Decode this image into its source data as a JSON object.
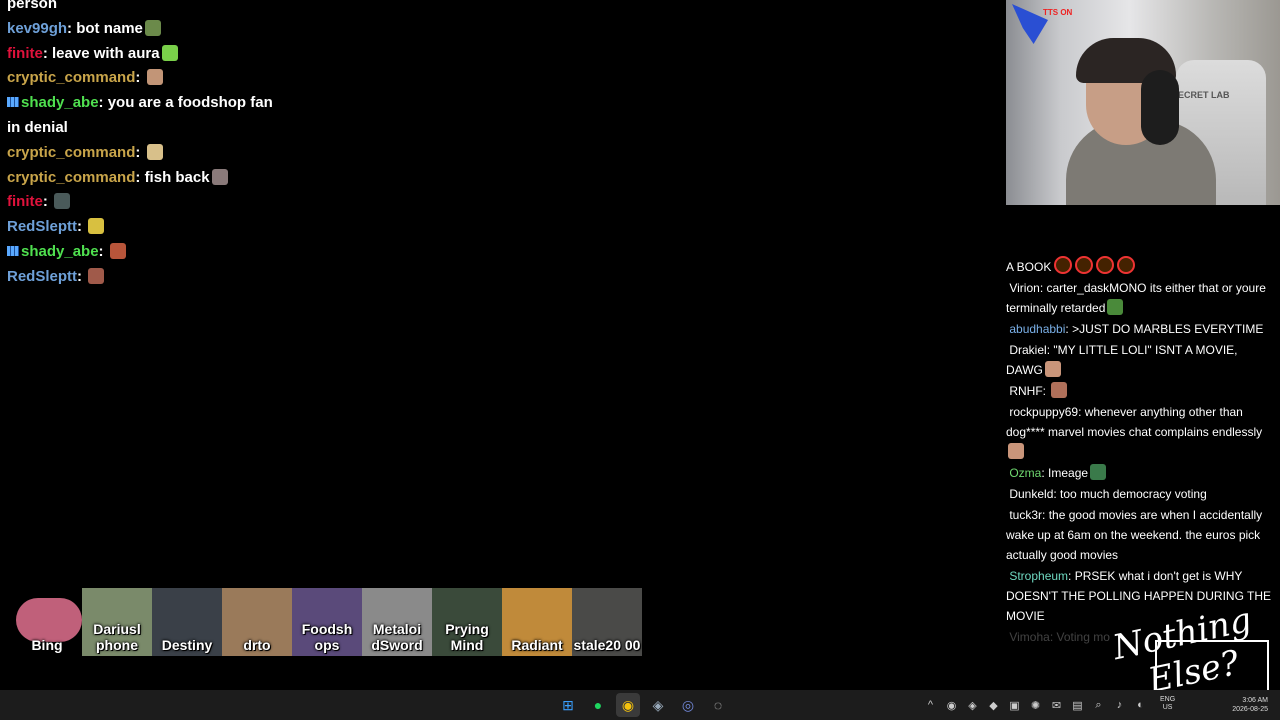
{
  "left_chat": {
    "lines": [
      {
        "user": "",
        "color": "#ffffff",
        "text": "person",
        "emote": false,
        "badge": false
      },
      {
        "user": "kev99gh",
        "color": "#6ea0d8",
        "text": "bot name",
        "emote": true,
        "emote_color": "#6b8a4a",
        "badge": false
      },
      {
        "user": "finite",
        "color": "#e0123c",
        "text": "leave with aura",
        "emote": true,
        "emote_color": "#7ad04a",
        "badge": false
      },
      {
        "user": "cryptic_command",
        "color": "#c9a54a",
        "text": "",
        "emote": true,
        "emote_color": "#c29577",
        "badge": false
      },
      {
        "user": "shady_abe",
        "color": "#4fe04f",
        "text": "you are a foodshop fan",
        "emote": false,
        "badge": true
      },
      {
        "user": "",
        "color": "#ffffff",
        "text": "in denial",
        "emote": false,
        "badge": false
      },
      {
        "user": "cryptic_command",
        "color": "#c9a54a",
        "text": "",
        "emote": true,
        "emote_color": "#d8c08a",
        "badge": false
      },
      {
        "user": "cryptic_command",
        "color": "#c9a54a",
        "text": "fish back",
        "emote": true,
        "emote_color": "#8a7a7a",
        "badge": false
      },
      {
        "user": "finite",
        "color": "#e0123c",
        "text": "",
        "emote": true,
        "emote_color": "#4a5a5a",
        "badge": false
      },
      {
        "user": "RedSleptt",
        "color": "#6ea0d8",
        "text": "",
        "emote": true,
        "emote_color": "#d8c040",
        "badge": false
      },
      {
        "user": "shady_abe",
        "color": "#4fe04f",
        "text": "",
        "emote": true,
        "emote_color": "#b8553a",
        "badge": true
      },
      {
        "user": "RedSleptt",
        "color": "#6ea0d8",
        "text": "",
        "emote": true,
        "emote_color": "#a05a4a",
        "badge": false
      }
    ]
  },
  "webcam": {
    "overlay_text": "TTS ON",
    "chair_text": "ECRET LAB"
  },
  "right_chat": {
    "messages": [
      {
        "user": "",
        "color": "#ffffff",
        "text": "A BOOK",
        "circles": 4
      },
      {
        "user": "Virion",
        "color": "#ffffff",
        "text": "carter_daskMONO its either that or youre terminally retarded",
        "emote": true,
        "emote_color": "#4a8a3a"
      },
      {
        "user": "abudhabbi",
        "color": "#7ab0e8",
        "text": ">JUST DO MARBLES EVERYTIME"
      },
      {
        "user": "Drakiel",
        "color": "#ffffff",
        "text": "\"MY LITTLE LOLI\" ISNT A MOVIE, DAWG",
        "emote": true,
        "emote_color": "#c9957a"
      },
      {
        "user": "RNHF",
        "color": "#ffffff",
        "text": "",
        "emote": true,
        "emote_color": "#b0705a"
      },
      {
        "user": "rockpuppy69",
        "color": "#ffffff",
        "text": "whenever anything other than dog**** marvel movies chat complains endlessly",
        "emote": true,
        "emote_color": "#c9957a"
      },
      {
        "user": "Ozma",
        "color": "#6fd86f",
        "text": "Imeage",
        "emote": true,
        "emote_color": "#3a7a4a"
      },
      {
        "user": "Dunkeld",
        "color": "#ffffff",
        "text": "too much democracy voting"
      },
      {
        "user": "tuck3r",
        "color": "#ffffff",
        "text": "the good movies are when I accidentally wake up at 6am on the weekend. the euros pick actually good movies"
      },
      {
        "user": "Stropheum",
        "color": "#6fd8c0",
        "text": "PRSEK what i don't get is WHY DOESN'T THE POLLING HAPPEN DURING THE MOVIE"
      },
      {
        "user": "Vimoha",
        "color": "#ffffff",
        "text": "Voting mo",
        "faded": true
      }
    ]
  },
  "logo": {
    "line1": "Nothing",
    "line2": "Else?"
  },
  "tiles": [
    {
      "label": "Bing",
      "color": "#000000"
    },
    {
      "label": "Dariusl phone",
      "color": "#7a8a6a"
    },
    {
      "label": "Destiny",
      "color": "#3a4048"
    },
    {
      "label": "drto",
      "color": "#9a7a5a"
    },
    {
      "label": "Foodsh ops",
      "color": "#5a4a7a"
    },
    {
      "label": "Metaloi dSword",
      "color": "#8a8a8a"
    },
    {
      "label": "Prying Mind",
      "color": "#3a4a3a"
    },
    {
      "label": "Radiant",
      "color": "#c08a3a"
    },
    {
      "label": "stale20 00",
      "color": "#4a4a48"
    }
  ],
  "taskbar": {
    "apps": [
      {
        "name": "windows-start-icon",
        "glyph": "⊞",
        "color": "#3aa0ff"
      },
      {
        "name": "spotify-icon",
        "glyph": "●",
        "color": "#1ed760"
      },
      {
        "name": "chrome-icon",
        "glyph": "◉",
        "color": "#f4c20d",
        "active": true
      },
      {
        "name": "steam-icon",
        "glyph": "◈",
        "color": "#9ab"
      },
      {
        "name": "discord-icon",
        "glyph": "◎",
        "color": "#7289da"
      },
      {
        "name": "obs-icon",
        "glyph": "◌",
        "color": "#ddd"
      }
    ],
    "tray": [
      {
        "name": "chevron-up-icon",
        "glyph": "^"
      },
      {
        "name": "chrome-tray-icon",
        "glyph": "◉"
      },
      {
        "name": "steam-tray-icon",
        "glyph": "◈"
      },
      {
        "name": "shield-icon",
        "glyph": "◆"
      },
      {
        "name": "folder-icon",
        "glyph": "▣"
      },
      {
        "name": "openai-icon",
        "glyph": "✺"
      },
      {
        "name": "mail-icon",
        "glyph": "✉"
      },
      {
        "name": "tray-app-icon",
        "glyph": "▤"
      },
      {
        "name": "search-tray-icon",
        "glyph": "⌕"
      },
      {
        "name": "microphone-icon",
        "glyph": "♪"
      },
      {
        "name": "network-icon",
        "glyph": "◐"
      }
    ],
    "lang_top": "ENG",
    "lang_bottom": "US",
    "time": "3:06 AM",
    "date": "2026-08-25"
  }
}
